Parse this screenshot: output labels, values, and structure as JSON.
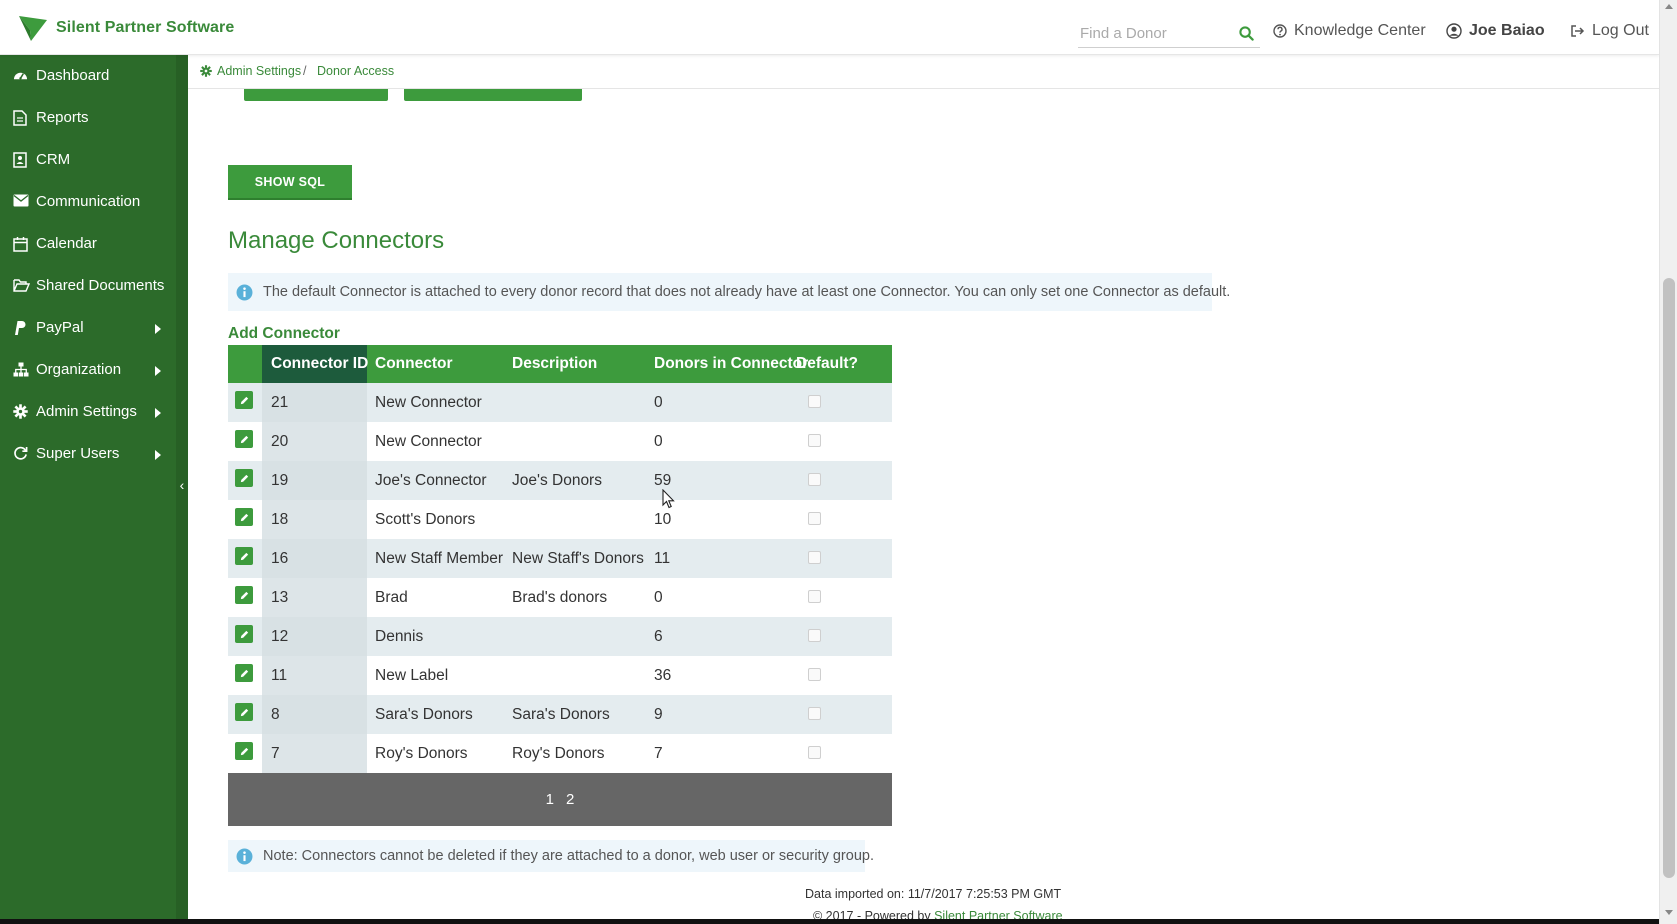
{
  "header": {
    "logo_text": "Silent Partner Software",
    "search_placeholder": "Find a Donor",
    "knowledge_center": "Knowledge Center",
    "user_name": "Joe Baiao",
    "logout": "Log Out"
  },
  "sidebar": {
    "items": [
      {
        "label": "Dashboard",
        "icon": "dashboard-icon"
      },
      {
        "label": "Reports",
        "icon": "reports-icon"
      },
      {
        "label": "CRM",
        "icon": "crm-icon"
      },
      {
        "label": "Communication",
        "icon": "envelope-icon"
      },
      {
        "label": "Calendar",
        "icon": "calendar-icon"
      },
      {
        "label": "Shared Documents",
        "icon": "folder-icon"
      },
      {
        "label": "PayPal",
        "icon": "paypal-icon"
      },
      {
        "label": "Organization",
        "icon": "org-icon"
      },
      {
        "label": "Admin Settings",
        "icon": "gear-icon"
      },
      {
        "label": "Super Users",
        "icon": "refresh-icon"
      }
    ],
    "collapse_glyph": "‹"
  },
  "breadcrumb": {
    "parent": "Admin Settings",
    "separator": "/",
    "current": "Donor Access"
  },
  "main": {
    "show_sql_label": "SHOW SQL",
    "section_title": "Manage Connectors",
    "info_text": "The default Connector is attached to every donor record that does not already have at least one Connector. You can only set one Connector as default.",
    "add_connector": "Add Connector",
    "note_text": "Note: Connectors cannot be deleted if they are attached to a donor, web user or security group."
  },
  "table": {
    "headers": [
      "Connector ID",
      "Connector",
      "Description",
      "Donors in Connector",
      "Default?"
    ],
    "rows": [
      {
        "id": "21",
        "connector": "New Connector",
        "description": "",
        "donors": "0"
      },
      {
        "id": "20",
        "connector": "New Connector",
        "description": "",
        "donors": "0"
      },
      {
        "id": "19",
        "connector": "Joe's Connector",
        "description": "Joe's Donors",
        "donors": "59"
      },
      {
        "id": "18",
        "connector": "Scott's Donors",
        "description": "",
        "donors": "10"
      },
      {
        "id": "16",
        "connector": "New Staff Member",
        "description": "New Staff's Donors",
        "donors": "11"
      },
      {
        "id": "13",
        "connector": "Brad",
        "description": "Brad's donors",
        "donors": "0"
      },
      {
        "id": "12",
        "connector": "Dennis",
        "description": "",
        "donors": "6"
      },
      {
        "id": "11",
        "connector": "New Label",
        "description": "",
        "donors": "36"
      },
      {
        "id": "8",
        "connector": "Sara's Donors",
        "description": "Sara's Donors",
        "donors": "9"
      },
      {
        "id": "7",
        "connector": "Roy's Donors",
        "description": "Roy's Donors",
        "donors": "7"
      }
    ],
    "pages": [
      "1",
      "2"
    ]
  },
  "footer": {
    "imported": "Data imported on: 11/7/2017 7:25:53 PM GMT",
    "copyright": "© 2017 - Powered by",
    "powered_link": "Silent Partner Software"
  },
  "colors": {
    "brand_green": "#3d9b3d",
    "sidebar_green": "#2c6b2a",
    "id_header": "#1d5b3c",
    "pager_gray": "#666666"
  }
}
